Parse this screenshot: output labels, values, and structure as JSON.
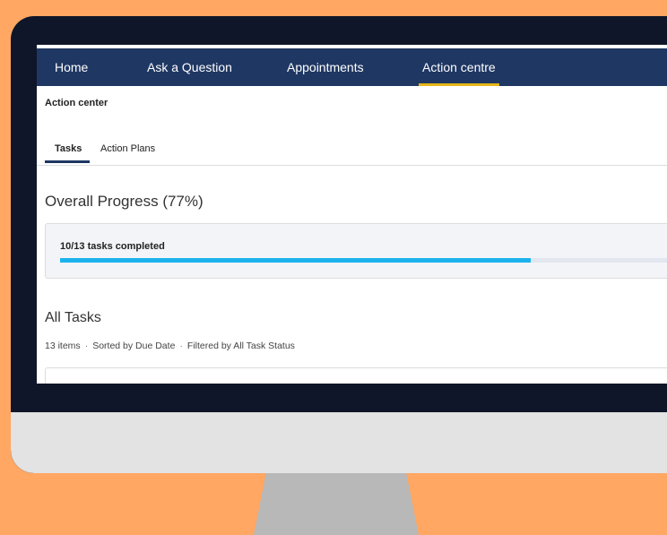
{
  "nav": {
    "items": [
      {
        "label": "Home",
        "active": false
      },
      {
        "label": "Ask a Question",
        "active": false
      },
      {
        "label": "Appointments",
        "active": false
      },
      {
        "label": "Action centre",
        "active": true
      }
    ]
  },
  "breadcrumb": "Action center",
  "tabs": [
    {
      "label": "Tasks",
      "active": true
    },
    {
      "label": "Action Plans",
      "active": false
    }
  ],
  "progress": {
    "title": "Overall Progress (77%)",
    "summary": "10/13 tasks completed",
    "completed": 10,
    "total": 13
  },
  "all_tasks": {
    "title": "All Tasks",
    "count": "13 items",
    "sort": "Sorted by Due Date",
    "filter": "Filtered by All Task Status",
    "separator": "·"
  },
  "colors": {
    "background": "#FFA763",
    "nav_bg": "#1F3763",
    "nav_active_underline": "#E3B51A",
    "progress_fill": "#1CB3EE"
  }
}
